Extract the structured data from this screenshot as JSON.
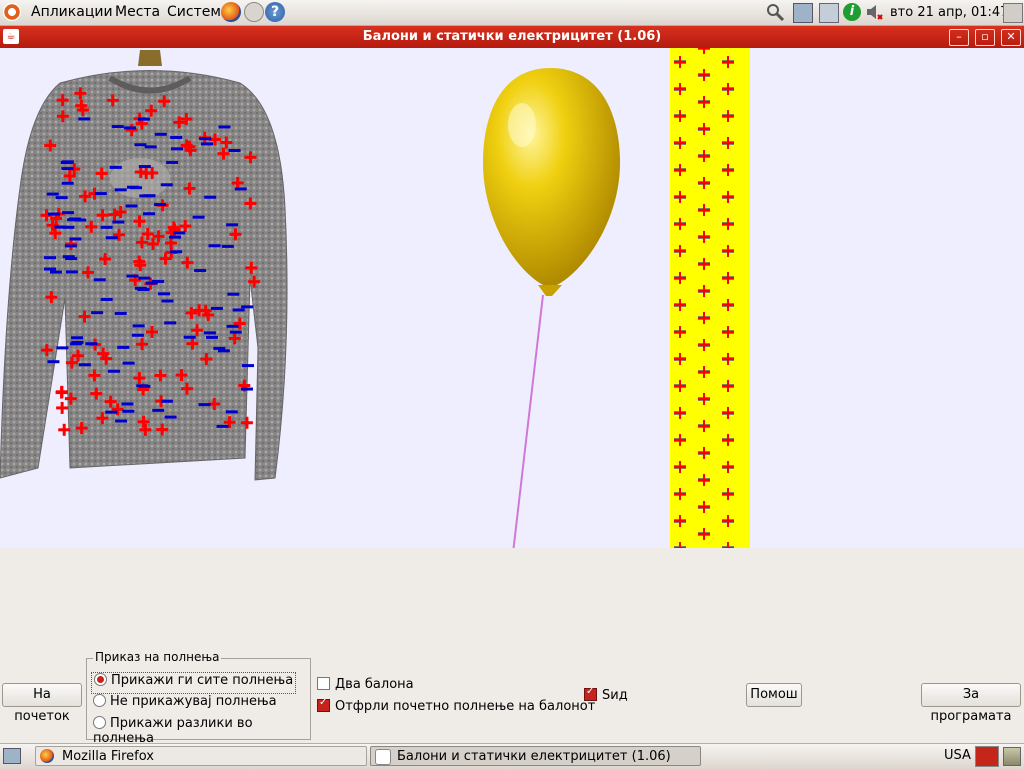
{
  "top_panel": {
    "menu": [
      "Апликации",
      "Места",
      "Систем"
    ],
    "clock": "вто 21 апр, 01:47"
  },
  "window": {
    "title": "Балони и статички електрицитет (1.06)"
  },
  "controls": {
    "reset_button": "На почеток",
    "charge_group": {
      "title": "Приказ на полнења",
      "options": [
        "Прикажи ги сите полнења",
        "Не прикажувај полнења",
        "Прикажи разлики во полнења"
      ],
      "selected": 0
    },
    "checkboxes": [
      {
        "label": "Два балона",
        "checked": false
      },
      {
        "label": "Отфрли почетно полнење на балонот",
        "checked": true
      }
    ],
    "wall_checkbox": {
      "label": "Ѕид",
      "checked": true
    },
    "help_button": "Помош",
    "about_button": "За програмата"
  },
  "taskbar": {
    "tasks": [
      "Mozilla Firefox",
      "Балони и статички електрицитет (1.06)"
    ],
    "keyboard_layout": "USA"
  },
  "colors": {
    "positive_charge": "#ff0000",
    "negative_charge": "#0000cc",
    "wall": "#ffff00",
    "balloon": "#e6c000",
    "titlebar": "#c4261a"
  }
}
